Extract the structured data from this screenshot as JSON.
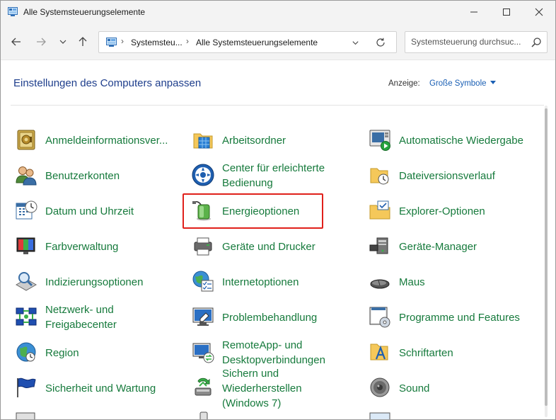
{
  "window": {
    "title": "Alle Systemsteuerungselemente"
  },
  "nav": {
    "breadcrumb": [
      "Systemsteu...",
      "Alle Systemsteuerungselemente"
    ],
    "search_placeholder": "Systemsteuerung durchsuc..."
  },
  "header": {
    "title": "Einstellungen des Computers anpassen",
    "view_label": "Anzeige:",
    "view_value": "Große Symbole"
  },
  "items": [
    {
      "label": "Anmeldeinformationsver...",
      "icon": "credential-manager-icon"
    },
    {
      "label": "Arbeitsordner",
      "icon": "work-folders-icon"
    },
    {
      "label": "Automatische Wiedergabe",
      "icon": "autoplay-icon"
    },
    {
      "label": "Benutzerkonten",
      "icon": "user-accounts-icon"
    },
    {
      "label_lines": [
        "Center für erleichterte",
        "Bedienung"
      ],
      "icon": "ease-of-access-icon"
    },
    {
      "label": "Dateiversionsverlauf",
      "icon": "file-history-icon"
    },
    {
      "label": "Datum und Uhrzeit",
      "icon": "date-time-icon"
    },
    {
      "label": "Energieoptionen",
      "icon": "power-options-icon"
    },
    {
      "label": "Explorer-Optionen",
      "icon": "explorer-options-icon"
    },
    {
      "label": "Farbverwaltung",
      "icon": "color-management-icon"
    },
    {
      "label": "Geräte und Drucker",
      "icon": "devices-printers-icon"
    },
    {
      "label": "Geräte-Manager",
      "icon": "device-manager-icon"
    },
    {
      "label": "Indizierungsoptionen",
      "icon": "indexing-options-icon"
    },
    {
      "label": "Internetoptionen",
      "icon": "internet-options-icon"
    },
    {
      "label": "Maus",
      "icon": "mouse-icon"
    },
    {
      "label_lines": [
        "Netzwerk- und",
        "Freigabecenter"
      ],
      "icon": "network-sharing-icon"
    },
    {
      "label": "Problembehandlung",
      "icon": "troubleshooting-icon"
    },
    {
      "label": "Programme und Features",
      "icon": "programs-features-icon"
    },
    {
      "label": "Region",
      "icon": "region-icon"
    },
    {
      "label_lines": [
        "RemoteApp- und",
        "Desktopverbindungen"
      ],
      "icon": "remoteapp-icon"
    },
    {
      "label": "Schriftarten",
      "icon": "fonts-icon"
    },
    {
      "label": "Sicherheit und Wartung",
      "icon": "security-maintenance-icon"
    },
    {
      "label_lines": [
        "Sichern und",
        "Wiederherstellen",
        "(Windows 7)"
      ],
      "icon": "backup-restore-icon"
    },
    {
      "label": "Sound",
      "icon": "sound-icon"
    }
  ],
  "colors": {
    "item_text": "#167a3c",
    "heading": "#1e3e8c",
    "link": "#1a5fb4",
    "highlight": "#e0201b"
  }
}
